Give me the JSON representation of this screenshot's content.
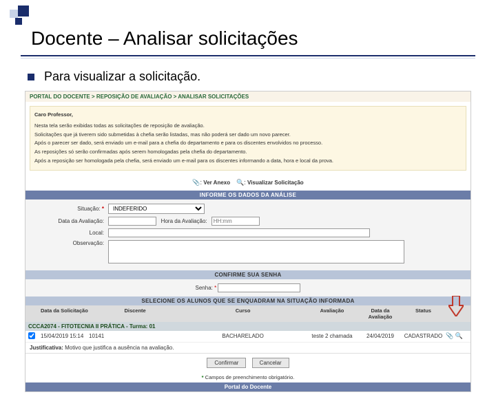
{
  "slide": {
    "title": "Docente – Analisar solicitações",
    "bullet": "Para visualizar a solicitação."
  },
  "breadcrumb": "PORTAL DO DOCENTE > REPOSIÇÃO DE AVALIAÇÃO > ANALISAR SOLICITAÇÕES",
  "info": {
    "dear": "Caro Professor,",
    "l1": "Nesta tela serão exibidas todas as solicitações de reposição de avaliação.",
    "l2": "Solicitações que já tiverem sido submetidas à chefia serão listadas, mas não poderá ser dado um novo parecer.",
    "l3": "Após o parecer ser dado, será enviado um e-mail para a chefia do departamento e para os discentes envolvidos no processo.",
    "l4": "As reposições só serão confirmadas após serem homologadas pela chefia do departamento.",
    "l5": "Após a reposição ser homologada pela chefia, será enviado um e-mail para os discentes informando a data, hora e local da prova."
  },
  "legend": {
    "anexo": "Ver Anexo",
    "visualizar": "Visualizar Solicitação"
  },
  "sections": {
    "analise": "INFORME OS DADOS DA ANÁLISE",
    "senha": "CONFIRME SUA SENHA",
    "alunos": "SELECIONE OS ALUNOS QUE SE ENQUADRAM NA SITUAÇÃO INFORMADA"
  },
  "form": {
    "situacao_label": "Situação:",
    "situacao_value": "INDEFERIDO",
    "data_label": "Data da Avaliação:",
    "hora_label": "Hora da Avaliação:",
    "hora_placeholder": "HH:mm",
    "local_label": "Local:",
    "obs_label": "Observação:",
    "senha_label": "Senha:"
  },
  "table": {
    "h_data": "Data da Solicitação",
    "h_discente": "Discente",
    "h_curso": "Curso",
    "h_aval": "Avaliação",
    "h_dataav": "Data da Avaliação",
    "h_status": "Status",
    "course_line": "CCCA2074 - FITOTECNIA II PRÁTICA - Turma: 01",
    "row": {
      "data": "15/04/2019 15:14",
      "discente": "10141",
      "curso": "BACHARELADO",
      "aval": "teste 2 chamada",
      "dataav": "24/04/2019",
      "status": "CADASTRADO"
    },
    "justif_label": "Justificativa:",
    "justif_text": " Motivo que justifica a ausência na avaliação."
  },
  "buttons": {
    "confirmar": "Confirmar",
    "cancelar": "Cancelar"
  },
  "req_note": "Campos de preenchimento obrigatório.",
  "footer": "Portal do Docente",
  "tooltip": "Ver Anexo"
}
